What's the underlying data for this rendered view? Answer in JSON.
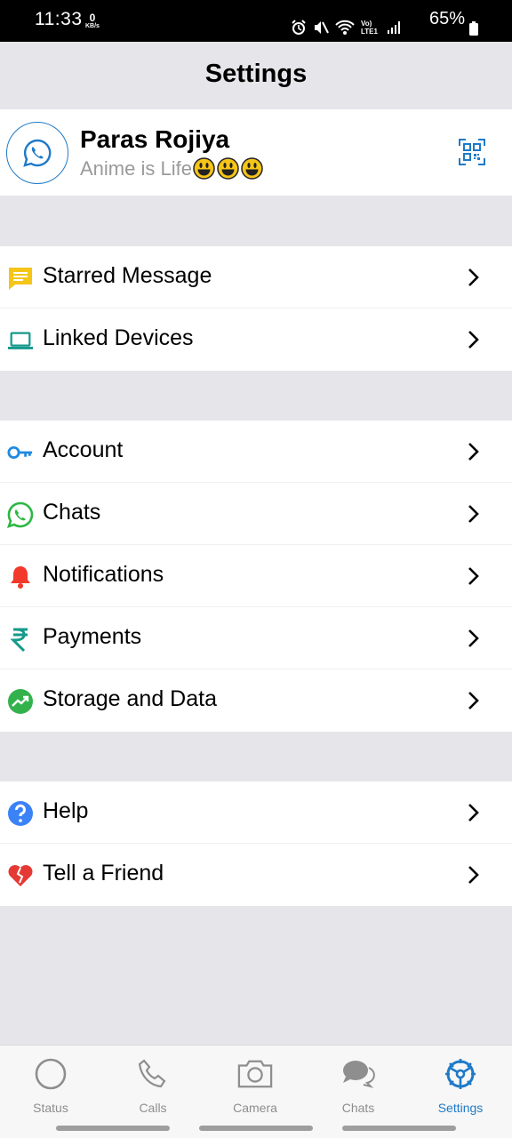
{
  "status_bar": {
    "time": "11:33",
    "speed_value": "0",
    "speed_unit": "KB/s",
    "network_label": "Vo) LTE1",
    "battery": "65%"
  },
  "header": {
    "title": "Settings"
  },
  "profile": {
    "name": "Paras Rojiya",
    "status": "Anime is Life"
  },
  "sections": [
    {
      "items": [
        {
          "label": "Starred Message",
          "icon": "starred-message-icon",
          "color": "#f5c518"
        },
        {
          "label": "Linked Devices",
          "icon": "laptop-icon",
          "color": "#14998b"
        }
      ]
    },
    {
      "items": [
        {
          "label": "Account",
          "icon": "key-icon",
          "color": "#1f8ae0"
        },
        {
          "label": "Chats",
          "icon": "whatsapp-icon",
          "color": "#2db742"
        },
        {
          "label": "Notifications",
          "icon": "bell-icon",
          "color": "#f2392c"
        },
        {
          "label": "Payments",
          "icon": "rupee-icon",
          "color": "#14998b"
        },
        {
          "label": "Storage and Data",
          "icon": "storage-icon",
          "color": "#33b24c"
        }
      ]
    },
    {
      "items": [
        {
          "label": "Help",
          "icon": "help-icon",
          "color": "#3b82f6"
        },
        {
          "label": "Tell a Friend",
          "icon": "heart-icon",
          "color": "#e53935"
        }
      ]
    }
  ],
  "tabs": [
    {
      "label": "Status",
      "icon": "status-icon",
      "active": false
    },
    {
      "label": "Calls",
      "icon": "phone-icon",
      "active": false
    },
    {
      "label": "Camera",
      "icon": "camera-icon",
      "active": false
    },
    {
      "label": "Chats",
      "icon": "chat-bubbles-icon",
      "active": false
    },
    {
      "label": "Settings",
      "icon": "settings-gear-icon",
      "active": true
    }
  ],
  "colors": {
    "accent": "#1f7ac7",
    "inactive": "#8e8e8e",
    "background": "#e5e5ea"
  }
}
